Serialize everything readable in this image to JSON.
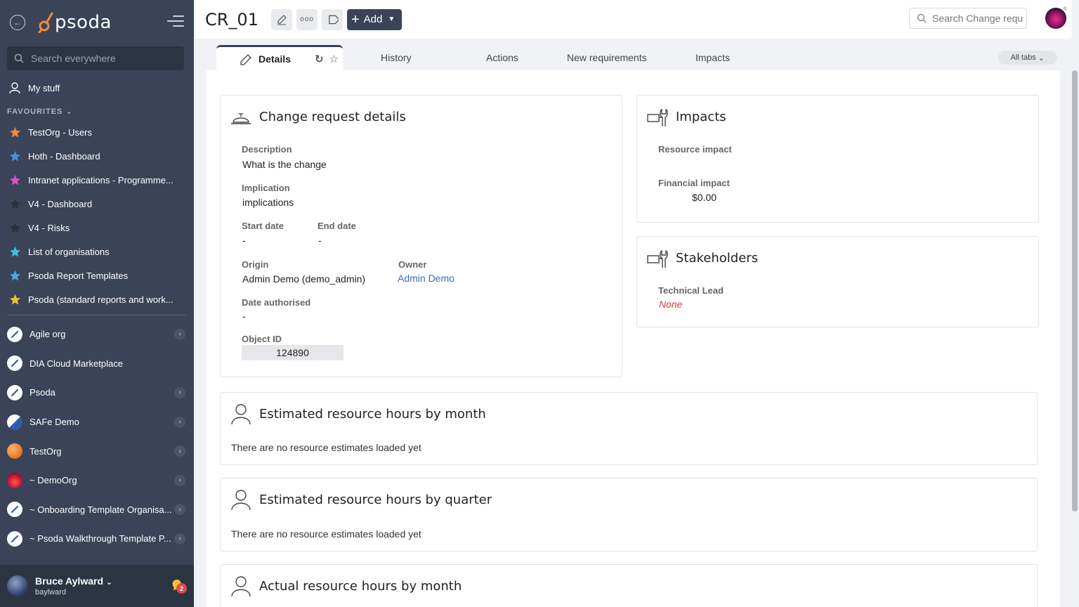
{
  "sidebar": {
    "logo_text": "psoda",
    "search_placeholder": "Search everywhere",
    "my_stuff": "My stuff",
    "favourites_header": "FAVOURITES",
    "favourites": [
      {
        "label": "TestOrg - Users",
        "star_color": "#f08a3c"
      },
      {
        "label": "Hoth - Dashboard",
        "star_color": "#4a8fe0"
      },
      {
        "label": "Intranet applications - Programme...",
        "star_color": "#e04fc4"
      },
      {
        "label": "V4 - Dashboard",
        "star_color": "#2b2f38"
      },
      {
        "label": "V4 - Risks",
        "star_color": "#2b2f38"
      },
      {
        "label": "List of organisations",
        "star_color": "#3fc2d8"
      },
      {
        "label": "Psoda Report Templates",
        "star_color": "#4aa9e0"
      },
      {
        "label": "Psoda (standard reports and work...",
        "star_color": "#f2c12e"
      }
    ],
    "orgs": [
      {
        "label": "Agile org",
        "icon": "compass-icon",
        "has_chevron": true
      },
      {
        "label": "DIA Cloud Marketplace",
        "icon": "compass-icon",
        "has_chevron": false
      },
      {
        "label": "Psoda",
        "icon": "compass-icon",
        "has_chevron": true
      },
      {
        "label": "SAFe Demo",
        "icon": "safe-logo-icon",
        "has_chevron": true
      },
      {
        "label": "TestOrg",
        "icon": "orange-orb-icon",
        "has_chevron": true
      },
      {
        "label": "~ DemoOrg",
        "icon": "sunset-orb-icon",
        "has_chevron": true
      },
      {
        "label": "~ Onboarding Template Organisa...",
        "icon": "compass-icon",
        "has_chevron": true
      },
      {
        "label": "~ Psoda Walkthrough Template P...",
        "icon": "compass-icon",
        "has_chevron": true
      }
    ],
    "user": {
      "name": "Bruce Aylward",
      "login": "baylward",
      "notifications": "2"
    }
  },
  "header": {
    "title": "CR_01",
    "add_label": "Add",
    "search_placeholder": "Search Change requ"
  },
  "tabs": {
    "items": [
      "Details",
      "History",
      "Actions",
      "New requirements",
      "Impacts"
    ],
    "all_tabs": "All tabs"
  },
  "details_card": {
    "title": "Change request details",
    "description_label": "Description",
    "description_value": "What is the change",
    "implication_label": "Implication",
    "implication_value": "implications",
    "start_label": "Start date",
    "start_value": "-",
    "end_label": "End date",
    "end_value": "-",
    "origin_label": "Origin",
    "origin_value": "Admin Demo (demo_admin)",
    "owner_label": "Owner",
    "owner_value": "Admin Demo",
    "authorised_label": "Date authorised",
    "authorised_value": "-",
    "objectid_label": "Object ID",
    "objectid_value": "124890"
  },
  "impacts_card": {
    "title": "Impacts",
    "resource_label": "Resource impact",
    "resource_value": "",
    "financial_label": "Financial impact",
    "financial_value": "$0.00"
  },
  "stakeholders_card": {
    "title": "Stakeholders",
    "lead_label": "Technical Lead",
    "lead_value": "None"
  },
  "resource_cards": [
    {
      "title": "Estimated resource hours by month",
      "message": "There are no resource estimates loaded yet"
    },
    {
      "title": "Estimated resource hours by quarter",
      "message": "There are no resource estimates loaded yet"
    },
    {
      "title": "Actual resource hours by month",
      "message": ""
    }
  ]
}
